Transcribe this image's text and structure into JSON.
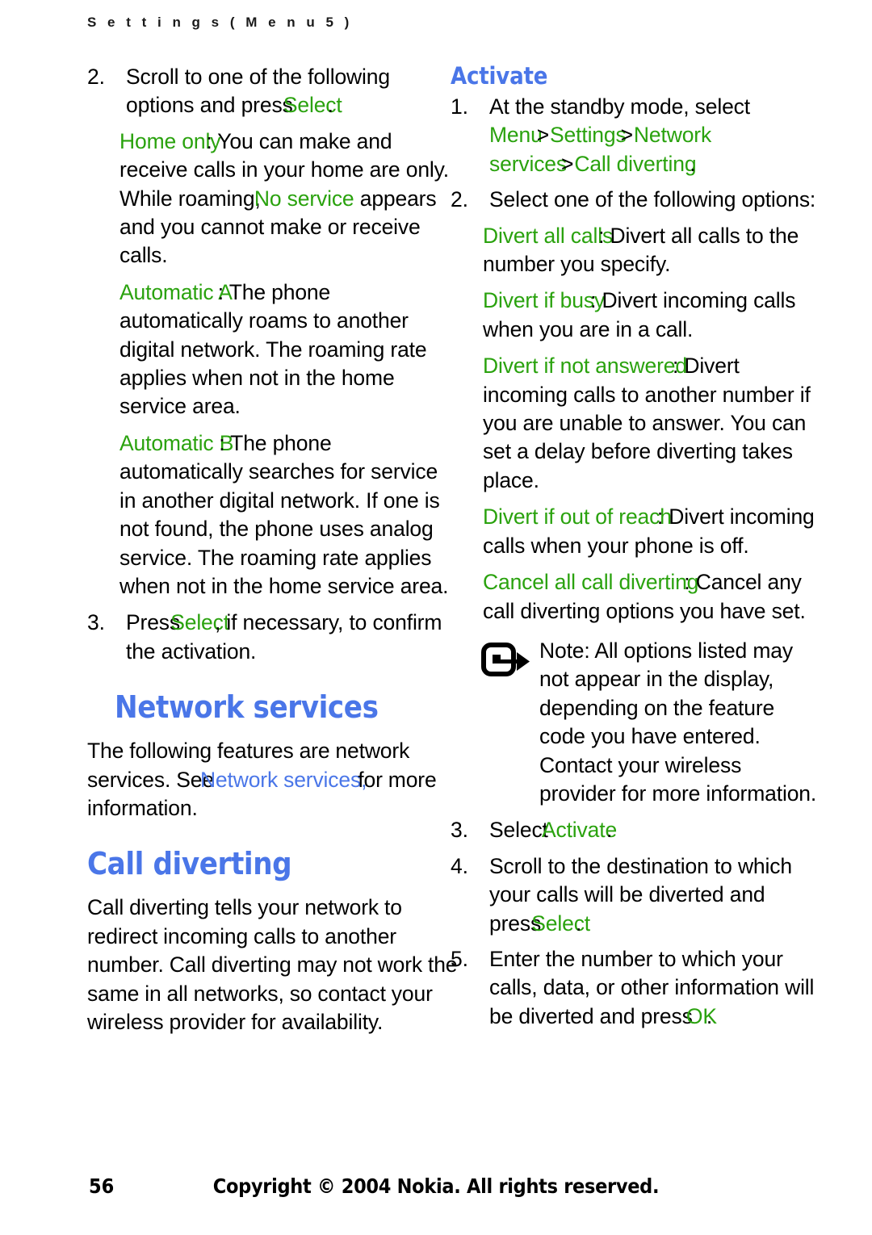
{
  "header": {
    "running_head": "S e t t i n g s   ( M e n u   5 )"
  },
  "colors": {
    "ui_term_green": "#2aa20e",
    "heading_blue": "#4a76e8",
    "body_black": "#000000"
  },
  "left_column": {
    "step2": {
      "num": "2.",
      "text_a": "Scroll to one of the following options and press ",
      "term": "Select",
      "text_b": "."
    },
    "option_home_only": {
      "term": "Home only",
      "text_a": ": You can make and receive calls in your home are only. While roaming, ",
      "term2": "No service",
      "text_b": " appears and you cannot make or receive calls."
    },
    "option_automatic_a": {
      "term": "Automatic A",
      "text": ": The phone automatically roams to another digital network. The roaming rate applies when not in the home service area."
    },
    "option_automatic_b": {
      "term": "Automatic B",
      "text": ": The phone automatically searches for service in another digital network. If one is not found, the phone uses analog service. The roaming rate applies when not in the home service area."
    },
    "step3": {
      "num": "3.",
      "text_a": "Press ",
      "term": "Select",
      "text_b": ", if necessary, to confirm the activation."
    },
    "heading_network_services": "Network services",
    "network_services_para": {
      "text_a": "The following features are network services. See ",
      "xref": "Network services,",
      "text_b": " for more information."
    },
    "heading_call_diverting": "Call diverting",
    "call_diverting_para": "Call diverting tells your network to redirect incoming calls to another number. Call diverting may not work the same in all networks, so contact your wireless provider for availability."
  },
  "right_column": {
    "heading_activate": "Activate",
    "step1": {
      "num": "1.",
      "text": "At the standby mode, select ",
      "path": [
        "Menu",
        "Settings",
        "Network services",
        "Call diverting"
      ],
      "separator": ">",
      "terminator": "."
    },
    "step2": {
      "num": "2.",
      "text": "Select one of the following options:"
    },
    "options": [
      {
        "term": "Divert all calls",
        "text": ": Divert all calls to the number you specify."
      },
      {
        "term": "Divert if busy",
        "text": ": Divert incoming calls when you are in a call."
      },
      {
        "term": "Divert if not answered",
        "text": ": Divert incoming calls to another number if you are unable to answer. You can set a delay before diverting takes place."
      },
      {
        "term": "Divert if out of reach",
        "text": ": Divert incoming calls when your phone is off."
      },
      {
        "term": "Cancel all call diverting",
        "text": ": Cancel any call diverting options you have set."
      }
    ],
    "note": {
      "icon": "note-arrow-icon",
      "label": "Note:",
      "text": " All options listed may not appear in the display, depending on the feature code you have entered. Contact your wireless provider for more information."
    },
    "step3": {
      "num": "3.",
      "text_a": "Select ",
      "term": "Activate",
      "text_b": "."
    },
    "step4": {
      "num": "4.",
      "text_a": "Scroll to the destination to which your calls will be diverted and press ",
      "term": "Select",
      "text_b": "."
    },
    "step5": {
      "num": "5.",
      "text_a": "Enter the number to which your calls, data, or other information will be diverted and press ",
      "term": "OK",
      "text_b": "."
    }
  },
  "footer": {
    "page_number": "56",
    "copyright": "Copyright © 2004 Nokia. All rights reserved."
  }
}
